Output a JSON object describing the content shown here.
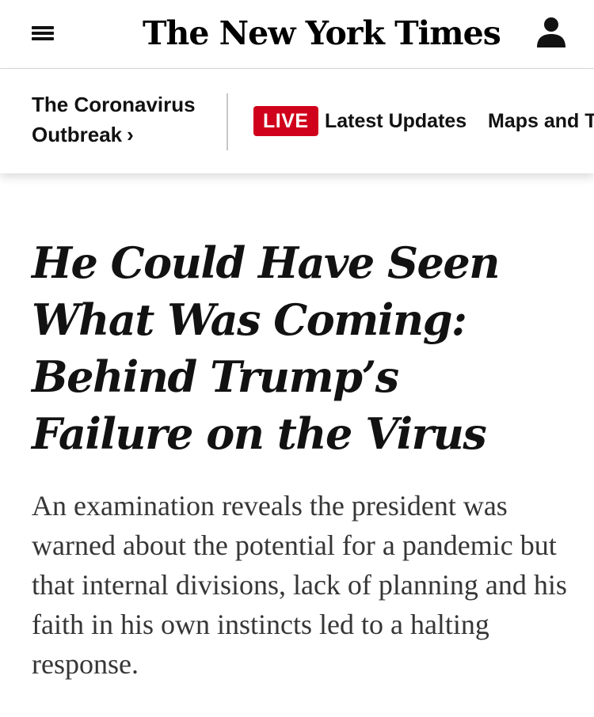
{
  "masthead": {
    "logo_text": "The New York Times",
    "menu_icon": "hamburger-menu-icon",
    "account_icon": "user-icon"
  },
  "section_bar": {
    "section_label": "The Coronavirus Outbreak",
    "section_chevron": "›",
    "live_badge": "LIVE",
    "live_color": "#d0021b",
    "nav_links": [
      "Latest Updates",
      "Maps and Tracker"
    ]
  },
  "article": {
    "headline": "He Could Have Seen What Was Coming: Behind Trump’s Failure on the Virus",
    "summary": "An examination reveals the president was warned about the potential for a pandemic but that internal divisions, lack of planning and his faith in his own instincts led to a halting response."
  }
}
